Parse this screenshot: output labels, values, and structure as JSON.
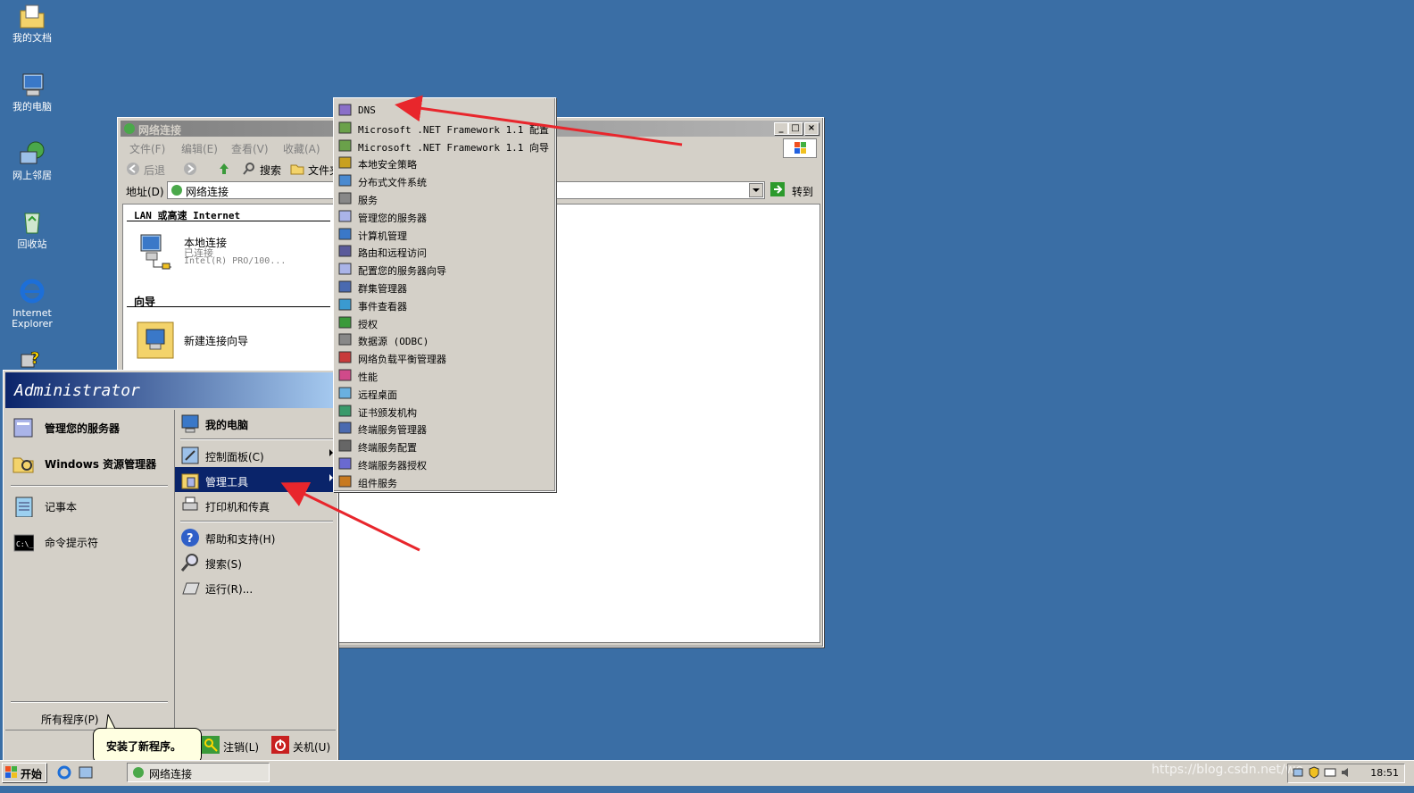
{
  "desktop": {
    "icons": [
      {
        "label": "我的文档"
      },
      {
        "label": "我的电脑"
      },
      {
        "label": "网上邻居"
      },
      {
        "label": "回收站"
      },
      {
        "label": "Internet Explorer"
      }
    ]
  },
  "window": {
    "title": "网络连接",
    "menu": [
      "文件(F)",
      "编辑(E)",
      "查看(V)",
      "收藏(A)"
    ],
    "toolbar": {
      "back": "后退",
      "search": "搜索",
      "folders": "文件夹"
    },
    "address_label": "地址(D)",
    "address_value": "网络连接",
    "go_label": "转到",
    "section_lan": "LAN 或高速 Internet",
    "local_conn": {
      "name": "本地连接",
      "status": "已连接",
      "device": "Intel(R) PRO/100..."
    },
    "section_wizard": "向导",
    "wizard_label": "新建连接向导"
  },
  "start_menu": {
    "user": "Administrator",
    "left_items": [
      "管理您的服务器",
      "Windows 资源管理器",
      "记事本",
      "命令提示符"
    ],
    "all_programs": "所有程序(P)",
    "right_items": [
      "我的电脑",
      "控制面板(C)",
      "管理工具",
      "打印机和传真",
      "帮助和支持(H)",
      "搜索(S)",
      "运行(R)..."
    ],
    "logoff": "注销(L)",
    "shutdown": "关机(U)"
  },
  "admin_tools": [
    "DNS",
    "Microsoft .NET Framework 1.1 配置",
    "Microsoft .NET Framework 1.1 向导",
    "本地安全策略",
    "分布式文件系统",
    "服务",
    "管理您的服务器",
    "计算机管理",
    "路由和远程访问",
    "配置您的服务器向导",
    "群集管理器",
    "事件查看器",
    "授权",
    "数据源 (ODBC)",
    "网络负载平衡管理器",
    "性能",
    "远程桌面",
    "证书颁发机构",
    "终端服务管理器",
    "终端服务配置",
    "终端服务器授权",
    "组件服务"
  ],
  "tooltip": "安装了新程序。",
  "taskbar": {
    "start": "开始",
    "task": "网络连接",
    "clock": "18:51",
    "watermark": "https://blog.csdn.net/we"
  },
  "colors": {
    "desktop": "#3a6ea5",
    "highlight": "#0a246a",
    "annotation": "#e8262c"
  }
}
